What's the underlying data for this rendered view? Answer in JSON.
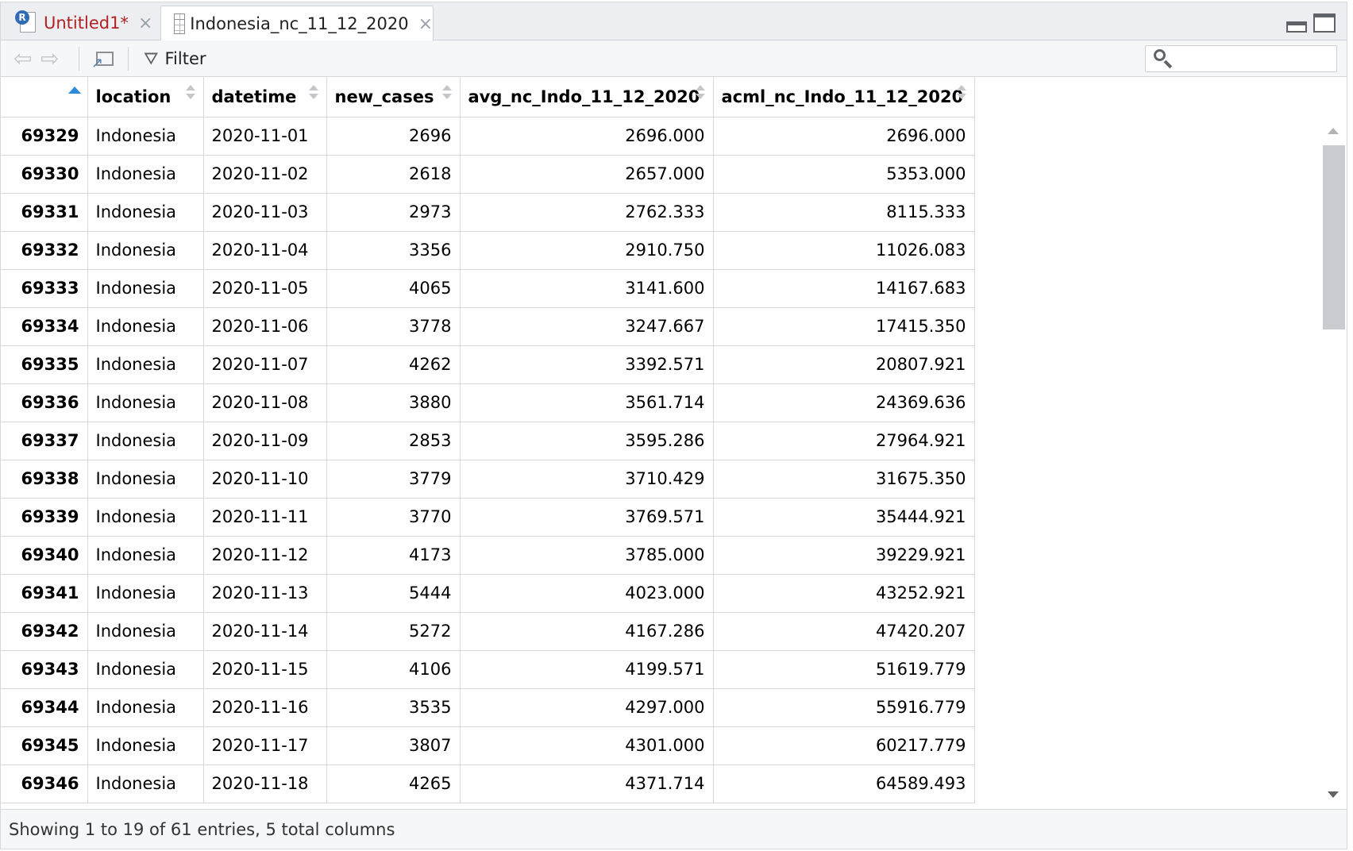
{
  "tabs": [
    {
      "label": "Untitled1*",
      "icon": "r-document-icon",
      "close": "×"
    },
    {
      "label": "Indonesia_nc_11_12_2020",
      "icon": "grid-icon",
      "close": "×",
      "active": true
    }
  ],
  "toolbar": {
    "back": "⇦",
    "forward": "⇨",
    "filter_label": "Filter",
    "filter_icon": "⛛",
    "search_placeholder": ""
  },
  "table": {
    "columns": [
      "",
      "location",
      "datetime",
      "new_cases",
      "avg_nc_Indo_11_12_2020",
      "acml_nc_Indo_11_12_2020"
    ],
    "rows": [
      [
        "69329",
        "Indonesia",
        "2020-11-01",
        "2696",
        "2696.000",
        "2696.000"
      ],
      [
        "69330",
        "Indonesia",
        "2020-11-02",
        "2618",
        "2657.000",
        "5353.000"
      ],
      [
        "69331",
        "Indonesia",
        "2020-11-03",
        "2973",
        "2762.333",
        "8115.333"
      ],
      [
        "69332",
        "Indonesia",
        "2020-11-04",
        "3356",
        "2910.750",
        "11026.083"
      ],
      [
        "69333",
        "Indonesia",
        "2020-11-05",
        "4065",
        "3141.600",
        "14167.683"
      ],
      [
        "69334",
        "Indonesia",
        "2020-11-06",
        "3778",
        "3247.667",
        "17415.350"
      ],
      [
        "69335",
        "Indonesia",
        "2020-11-07",
        "4262",
        "3392.571",
        "20807.921"
      ],
      [
        "69336",
        "Indonesia",
        "2020-11-08",
        "3880",
        "3561.714",
        "24369.636"
      ],
      [
        "69337",
        "Indonesia",
        "2020-11-09",
        "2853",
        "3595.286",
        "27964.921"
      ],
      [
        "69338",
        "Indonesia",
        "2020-11-10",
        "3779",
        "3710.429",
        "31675.350"
      ],
      [
        "69339",
        "Indonesia",
        "2020-11-11",
        "3770",
        "3769.571",
        "35444.921"
      ],
      [
        "69340",
        "Indonesia",
        "2020-11-12",
        "4173",
        "3785.000",
        "39229.921"
      ],
      [
        "69341",
        "Indonesia",
        "2020-11-13",
        "5444",
        "4023.000",
        "43252.921"
      ],
      [
        "69342",
        "Indonesia",
        "2020-11-14",
        "5272",
        "4167.286",
        "47420.207"
      ],
      [
        "69343",
        "Indonesia",
        "2020-11-15",
        "4106",
        "4199.571",
        "51619.779"
      ],
      [
        "69344",
        "Indonesia",
        "2020-11-16",
        "3535",
        "4297.000",
        "55916.779"
      ],
      [
        "69345",
        "Indonesia",
        "2020-11-17",
        "3807",
        "4301.000",
        "60217.779"
      ],
      [
        "69346",
        "Indonesia",
        "2020-11-18",
        "4265",
        "4371.714",
        "64589.493"
      ]
    ]
  },
  "status": {
    "text": "Showing 1 to 19 of 61 entries, 5 total columns"
  },
  "colors": {
    "dirty_tab": "#b22222",
    "sort_active": "#2b8ad9",
    "border": "#d6d8dc"
  }
}
